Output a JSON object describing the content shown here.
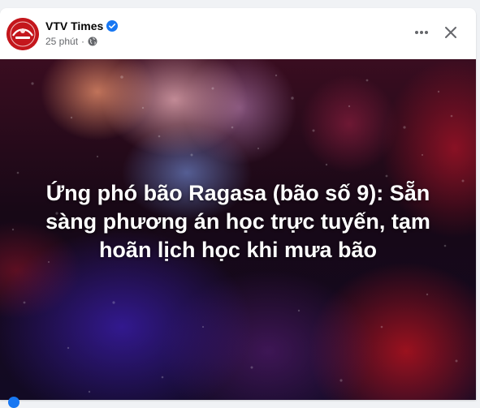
{
  "post": {
    "page_name": "VTV Times",
    "time_ago": "25 phút",
    "separator": "·",
    "headline_lines": [
      "Ứng phó bão Ragasa (bão số 9): Sẵn",
      "sàng phương án học trực tuyến, tạm",
      "hoãn lịch học khi mưa bão"
    ]
  },
  "icons": {
    "verified": "verified-badge-icon",
    "privacy": "globe-icon",
    "more": "more-horizontal-icon",
    "close": "close-icon"
  },
  "colors": {
    "verified_blue": "#1877f2",
    "name_text": "#050505",
    "meta_text": "#65676b",
    "avatar_red": "#c4161c"
  }
}
